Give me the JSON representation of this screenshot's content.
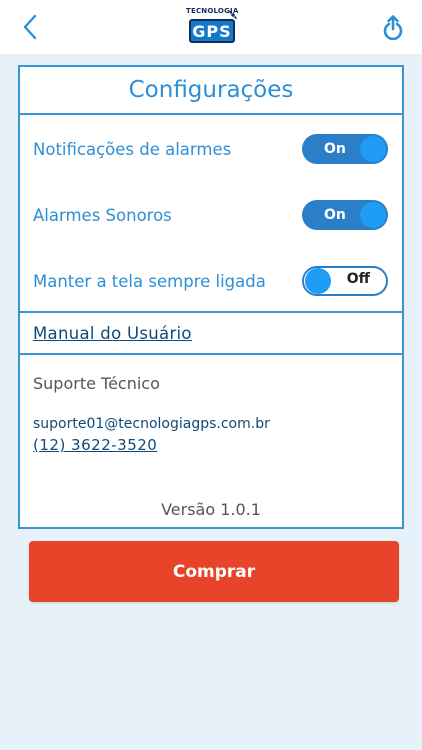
{
  "header": {
    "logo_top": "TECNOLOGIA",
    "logo_main": "GPS",
    "back_icon": "chevron-left-icon",
    "share_icon": "share-upload-icon"
  },
  "settings": {
    "title": "Configurações",
    "items": [
      {
        "label": "Notificações de alarmes",
        "state": "On"
      },
      {
        "label": "Alarmes Sonoros",
        "state": "On"
      },
      {
        "label": "Manter a tela sempre ligada",
        "state": "Off"
      }
    ]
  },
  "manual": {
    "label": "Manual do Usuário"
  },
  "support": {
    "title": "Suporte Técnico",
    "email": "suporte01@tecnologiagps.com.br",
    "phone": "(12) 3622-3520"
  },
  "version": "Versão 1.0.1",
  "buy_button": {
    "label": "Comprar"
  },
  "colors": {
    "accent": "#2e8fd6",
    "border": "#3a95d8",
    "background": "#e6f1fa",
    "buy": "#e8442a",
    "link": "#0f4a7a"
  }
}
